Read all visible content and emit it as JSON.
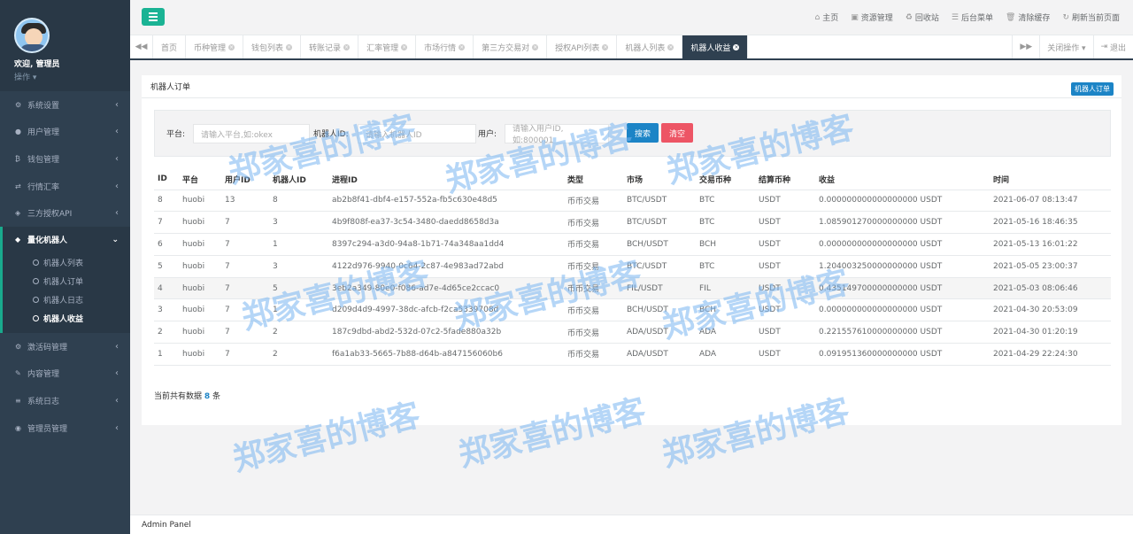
{
  "sidebar": {
    "welcome": "欢迎, 管理员",
    "ops": "操作 ▾",
    "items_top": [
      {
        "label": "系统设置",
        "icon": "gear-icon"
      },
      {
        "label": "用户管理",
        "icon": "users-icon"
      },
      {
        "label": "钱包管理",
        "icon": "bitcoin-icon"
      },
      {
        "label": "行情汇率",
        "icon": "exchange-icon"
      },
      {
        "label": "三方授权API",
        "icon": "cube-icon"
      }
    ],
    "active_label": "量化机器人",
    "sub_items": [
      "机器人列表",
      "机器人订单",
      "机器人日志",
      "机器人收益"
    ],
    "items_bottom": [
      {
        "label": "激活码管理"
      },
      {
        "label": "内容管理"
      },
      {
        "label": "系统日志"
      },
      {
        "label": "管理员管理"
      }
    ]
  },
  "toplinks": [
    "主页",
    "资源管理",
    "回收站",
    "后台菜单",
    "清除缓存",
    "刷新当前页面"
  ],
  "tabs": [
    "首页",
    "币种管理",
    "钱包列表",
    "转账记录",
    "汇率管理",
    "市场行情",
    "第三方交易对",
    "授权API列表",
    "机器人列表",
    "机器人收益"
  ],
  "tabs_right": {
    "close_ops": "关闭操作 ▾",
    "logout": "退出"
  },
  "panel": {
    "title": "机器人订单",
    "badge": "机器人订单",
    "filter": {
      "platform_label": "平台:",
      "platform_placeholder": "请输入平台,如:okex",
      "robot_label": "机器人ID:",
      "robot_placeholder": "请输入机器人ID",
      "user_label": "用户:",
      "user_placeholder": "请输入用户ID,如:800001",
      "search": "搜索",
      "clear": "清空"
    },
    "columns": [
      "ID",
      "平台",
      "用户ID",
      "机器人ID",
      "进程ID",
      "类型",
      "市场",
      "交易币种",
      "结算币种",
      "收益",
      "时间"
    ],
    "rows": [
      [
        "8",
        "huobi",
        "13",
        "8",
        "ab2b8f41-dbf4-e157-552a-fb5c630e48d5",
        "币币交易",
        "BTC/USDT",
        "BTC",
        "USDT",
        "0.000000000000000000 USDT",
        "2021-06-07 08:13:47"
      ],
      [
        "7",
        "huobi",
        "7",
        "3",
        "4b9f808f-ea37-3c54-3480-daedd8658d3a",
        "币币交易",
        "BTC/USDT",
        "BTC",
        "USDT",
        "1.085901270000000000 USDT",
        "2021-05-16 18:46:35"
      ],
      [
        "6",
        "huobi",
        "7",
        "1",
        "8397c294-a3d0-94a8-1b71-74a348aa1dd4",
        "币币交易",
        "BCH/USDT",
        "BCH",
        "USDT",
        "0.000000000000000000 USDT",
        "2021-05-13 16:01:22"
      ],
      [
        "5",
        "huobi",
        "7",
        "3",
        "4122d976-9940-0c64-2c87-4e983ad72abd",
        "币币交易",
        "BTC/USDT",
        "BTC",
        "USDT",
        "1.204003250000000000 USDT",
        "2021-05-05 23:00:37"
      ],
      [
        "4",
        "huobi",
        "7",
        "5",
        "3eb2a349-80e0-f086-ad7e-4d65ce2ccac0",
        "币币交易",
        "FIL/USDT",
        "FIL",
        "USDT",
        "0.435149700000000000 USDT",
        "2021-05-03 08:06:46"
      ],
      [
        "3",
        "huobi",
        "7",
        "1",
        "d209d4d9-4997-38dc-afcb-f2ca5339708d",
        "币币交易",
        "BCH/USDT",
        "BCH",
        "USDT",
        "0.000000000000000000 USDT",
        "2021-04-30 20:53:09"
      ],
      [
        "2",
        "huobi",
        "7",
        "2",
        "187c9dbd-abd2-532d-07c2-5fade880a32b",
        "币币交易",
        "ADA/USDT",
        "ADA",
        "USDT",
        "0.221557610000000000 USDT",
        "2021-04-30 01:20:19"
      ],
      [
        "1",
        "huobi",
        "7",
        "2",
        "f6a1ab33-5665-7b88-d64b-a847156060b6",
        "币币交易",
        "ADA/USDT",
        "ADA",
        "USDT",
        "0.091951360000000000 USDT",
        "2021-04-29 22:24:30"
      ]
    ],
    "total_prefix": "当前共有数据",
    "total_count": "8",
    "total_suffix": "条"
  },
  "footer": "Admin Panel",
  "watermark": "郑家喜的博客",
  "colors": {
    "sidebar": "#2f4050",
    "accent": "#1ab394",
    "primary": "#1c84c6",
    "danger": "#ed5565"
  }
}
